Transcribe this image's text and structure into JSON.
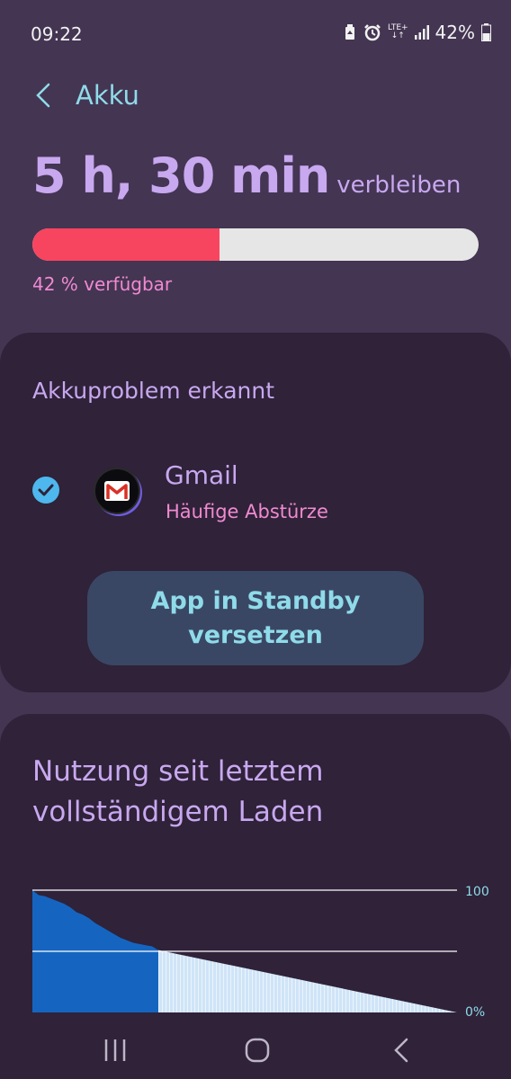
{
  "status_bar": {
    "time": "09:22",
    "icons": [
      "recycle-icon",
      "alarm-icon",
      "lte-icon",
      "signal-icon"
    ],
    "network_top": "LTE+",
    "network_bottom": "↓↑",
    "battery_percent": "42%",
    "battery_icon": "battery-icon"
  },
  "header": {
    "back_icon": "chevron-left-icon",
    "title": "Akku"
  },
  "battery": {
    "remaining_value": "5 h, 30 min",
    "remaining_suffix": "verbleiben",
    "level_percent": 42,
    "fill_color": "#f7455f",
    "available_text": "42 % verfügbar"
  },
  "problem_card": {
    "title": "Akkuproblem erkannt",
    "app": {
      "name": "Gmail",
      "subtitle": "Häufige Abstürze",
      "checked": true,
      "icon": "gmail-icon"
    },
    "button_label": "App in Standby versetzen"
  },
  "usage_card": {
    "title": "Nutzung seit letztem vollständigem Laden"
  },
  "chart_data": {
    "type": "area",
    "y_tick_labels": [
      "100",
      "0%"
    ],
    "ylim": [
      0,
      100
    ],
    "grid": true,
    "series": [
      {
        "values": [
          100,
          96,
          95,
          93,
          91,
          89,
          86,
          82,
          80,
          77,
          73,
          70,
          67,
          64,
          61,
          59,
          57,
          56,
          55,
          54,
          51
        ]
      },
      {
        "values": [
          51,
          0
        ]
      }
    ],
    "colors": {
      "actual": "#1565c0",
      "estimate": "#cfe4f7"
    }
  },
  "nav_bar": {
    "recents_icon": "recents-icon",
    "home_icon": "home-icon",
    "back_icon": "back-icon"
  }
}
